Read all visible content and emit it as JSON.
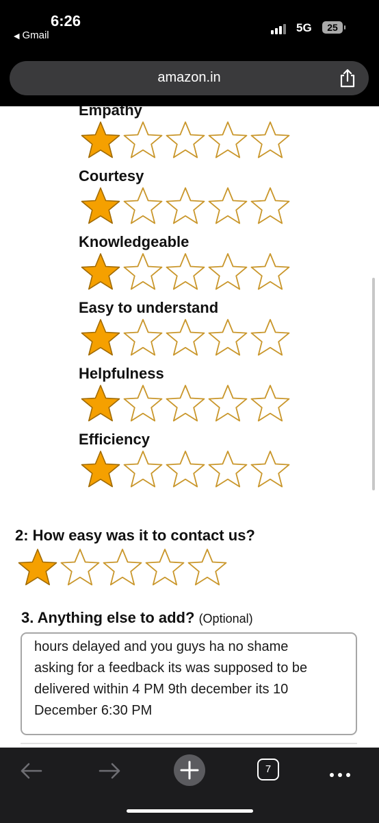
{
  "status_bar": {
    "time": "6:26",
    "back_app": "Gmail",
    "network": "5G",
    "battery": "25"
  },
  "url_bar": {
    "url": "amazon.in"
  },
  "ratings": {
    "attributes": [
      {
        "label": "Empathy",
        "rating": 1,
        "max": 5
      },
      {
        "label": "Courtesy",
        "rating": 1,
        "max": 5
      },
      {
        "label": "Knowledgeable",
        "rating": 1,
        "max": 5
      },
      {
        "label": "Easy to understand",
        "rating": 1,
        "max": 5
      },
      {
        "label": "Helpfulness",
        "rating": 1,
        "max": 5
      },
      {
        "label": "Efficiency",
        "rating": 1,
        "max": 5
      }
    ]
  },
  "question2": {
    "title": "2: How easy was it to contact us?",
    "rating": 1,
    "max": 5
  },
  "question3": {
    "title": "3. Anything else to add?",
    "optional": "(Optional)",
    "text_lines": [
      "hours delayed and you guys ha no shame",
      "asking for a feedback its was supposed to be",
      "delivered within  4 PM 9th december its 10",
      "December 6:30 PM"
    ]
  },
  "toolbar": {
    "back_icon": "arrow-left-icon",
    "forward_icon": "arrow-right-icon",
    "new_tab_icon": "plus-icon",
    "tab_count": "7",
    "more_icon": "ellipsis-icon"
  },
  "colors": {
    "star_fill": "#f5a000",
    "star_outline": "#c9962a",
    "toolbar_bg": "#1c1c1e",
    "url_bar_bg": "#3a3a3c"
  }
}
